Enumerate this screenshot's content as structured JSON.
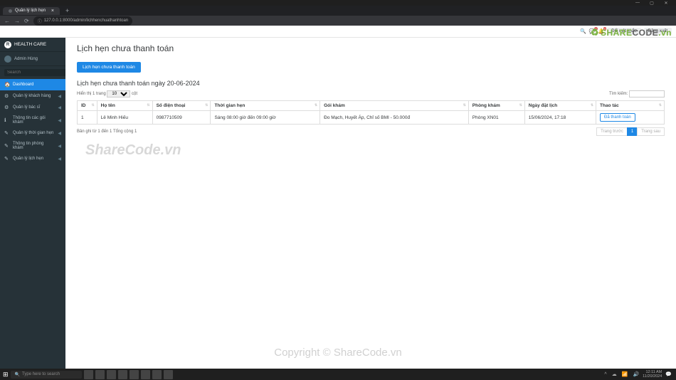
{
  "window": {
    "title": "Quản lý lịch hẹn"
  },
  "browser": {
    "tab_title": "Quản lý lịch hẹn",
    "url": "127.0.0.1:8000/admin/lichhenchuathanhtoan"
  },
  "header": {
    "change_password": "Đổi mật khẩu",
    "logout": "Đăng xuất"
  },
  "sidebar": {
    "brand": "HEALTH CARE",
    "user": "Admin Hùng",
    "search_placeholder": "Search",
    "items": [
      {
        "icon": "🏠",
        "label": "Dashboard",
        "active": true,
        "caret": false
      },
      {
        "icon": "⚙",
        "label": "Quản lý khách hàng",
        "caret": true
      },
      {
        "icon": "⚙",
        "label": "Quản lý bác sĩ",
        "caret": true
      },
      {
        "icon": "ℹ",
        "label": "Thông tin các gói khám",
        "caret": true
      },
      {
        "icon": "✎",
        "label": "Quản lý thời gian hẹn",
        "caret": true
      },
      {
        "icon": "✎",
        "label": "Thông tin phòng khám",
        "caret": true
      },
      {
        "icon": "✎",
        "label": "Quản lý lịch hẹn",
        "caret": true
      }
    ]
  },
  "page": {
    "title": "Lịch hẹn chưa thanh toán",
    "button": "Lịch hẹn chưa thanh toán",
    "subtitle": "Lịch hẹn chưa thanh toán ngày 20-06-2024",
    "show_prefix": "Hiển thị 1 trang",
    "show_value": "10",
    "show_suffix": "cột",
    "search_label": "Tìm kiếm:",
    "columns": [
      "ID",
      "Họ tên",
      "Số điện thoại",
      "Thời gian hẹn",
      "Gói khám",
      "Phòng khám",
      "Ngày đặt lịch",
      "Thao tác"
    ],
    "rows": [
      {
        "id": "1",
        "name": "Lê Minh Hiếu",
        "phone": "0987710509",
        "time": "Sáng 08:00 giờ đến 09:00 giờ",
        "package": "Đo Mạch, Huyết Áp, Chỉ số BMI - 50.000đ",
        "room": "Phòng XN01",
        "date": "15/06/2024, 17:18",
        "action": "Đã thanh toán"
      }
    ],
    "footer_info": "Bản ghi từ 1 đến 1 Tổng cộng 1",
    "pager_prev": "Trang trước",
    "pager_current": "1",
    "pager_next": "Trang sau"
  },
  "taskbar": {
    "search": "Type here to search",
    "time": "12:11 AM",
    "date": "11/20/2024"
  },
  "watermark": {
    "wm1": "ShareCode.vn",
    "wm2": "Copyright © ShareCode.vn",
    "wm3a": "SHARE",
    "wm3b": "CODE",
    "wm3c": ".vn"
  }
}
